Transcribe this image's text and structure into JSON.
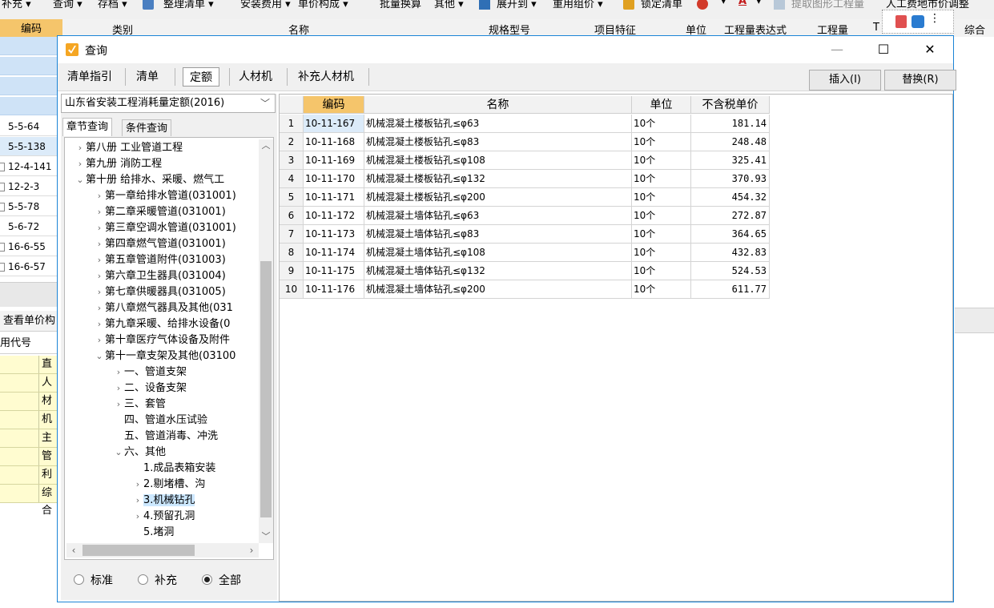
{
  "toolbar": {
    "items": [
      "补充 ▾",
      "查询 ▾",
      "存档 ▾",
      "整理清单 ▾",
      "安装费用 ▾",
      "单价构成 ▾",
      "批量换算",
      "其他 ▾",
      "展开到 ▾",
      "重用组价 ▾",
      "锁定清单",
      "▾",
      "▾",
      "提取图形工程量",
      "人工费地市价调整"
    ]
  },
  "bg_grid": {
    "headers": [
      "编码",
      "类别",
      "名称",
      "规格型号",
      "项目特征",
      "单位",
      "工程量表达式",
      "工程量",
      "T",
      "综合单"
    ],
    "rows": [
      "5-5-64",
      "5-5-138",
      "12-4-141",
      "12-2-3",
      "5-5-78",
      "5-6-72",
      "16-6-55",
      "16-6-57"
    ],
    "check_tab": "查看单价构",
    "code_header": "用代号",
    "yellow_rows": [
      "直接",
      "人工",
      "材料",
      "机械",
      "主材",
      "管理",
      "利润",
      "综合"
    ]
  },
  "dialog": {
    "title": "查询",
    "tabs": [
      "清单指引",
      "清单",
      "定额",
      "人材机",
      "补充人材机"
    ],
    "active_tab": "定额",
    "insert_button": "插入(I)",
    "replace_button": "替换(R)",
    "quota_library": "山东省安装工程消耗量定额(2016)",
    "subtabs": [
      "章节查询",
      "条件查询"
    ],
    "tree": [
      {
        "label": "第八册 工业管道工程",
        "arrow": "›"
      },
      {
        "label": "第九册 消防工程",
        "arrow": "›"
      },
      {
        "label": "第十册 给排水、采暖、燃气工",
        "arrow": "⌄"
      },
      {
        "label": "第一章给排水管道(031001)",
        "arrow": "›"
      },
      {
        "label": "第二章采暖管道(031001)",
        "arrow": "›"
      },
      {
        "label": "第三章空调水管道(031001)",
        "arrow": "›"
      },
      {
        "label": "第四章燃气管道(031001)",
        "arrow": "›"
      },
      {
        "label": "第五章管道附件(031003)",
        "arrow": "›"
      },
      {
        "label": "第六章卫生器具(031004)",
        "arrow": "›"
      },
      {
        "label": "第七章供暖器具(031005)",
        "arrow": "›"
      },
      {
        "label": "第八章燃气器具及其他(031",
        "arrow": "›"
      },
      {
        "label": "第九章采暖、给排水设备(0",
        "arrow": "›"
      },
      {
        "label": "第十章医疗气体设备及附件",
        "arrow": "›"
      },
      {
        "label": "第十一章支架及其他(03100",
        "arrow": "⌄"
      },
      {
        "label": "一、管道支架",
        "arrow": "›"
      },
      {
        "label": "二、设备支架",
        "arrow": "›"
      },
      {
        "label": "三、套管",
        "arrow": "›"
      },
      {
        "label": "四、管道水压试验",
        "arrow": ""
      },
      {
        "label": "五、管道消毒、冲洗",
        "arrow": ""
      },
      {
        "label": "六、其他",
        "arrow": "⌄"
      },
      {
        "label": "1.成品表箱安装",
        "arrow": ""
      },
      {
        "label": "2.剔堵槽、沟",
        "arrow": "›"
      },
      {
        "label": "3.机械钻孔",
        "arrow": "›"
      },
      {
        "label": "4.预留孔洞",
        "arrow": "›"
      },
      {
        "label": "5.堵洞",
        "arrow": ""
      }
    ],
    "radio_options": [
      "标准",
      "补充",
      "全部"
    ],
    "radio_selected": "全部",
    "grid": {
      "headers": [
        "编码",
        "名称",
        "单位",
        "不含税单价"
      ],
      "rows": [
        {
          "n": "1",
          "code": "10-11-167",
          "name": "机械混凝土楼板钻孔≤φ63",
          "unit": "10个",
          "price": "181.14"
        },
        {
          "n": "2",
          "code": "10-11-168",
          "name": "机械混凝土楼板钻孔≤φ83",
          "unit": "10个",
          "price": "248.48"
        },
        {
          "n": "3",
          "code": "10-11-169",
          "name": "机械混凝土楼板钻孔≤φ108",
          "unit": "10个",
          "price": "325.41"
        },
        {
          "n": "4",
          "code": "10-11-170",
          "name": "机械混凝土楼板钻孔≤φ132",
          "unit": "10个",
          "price": "370.93"
        },
        {
          "n": "5",
          "code": "10-11-171",
          "name": "机械混凝土楼板钻孔≤φ200",
          "unit": "10个",
          "price": "454.32"
        },
        {
          "n": "6",
          "code": "10-11-172",
          "name": "机械混凝土墙体钻孔≤φ63",
          "unit": "10个",
          "price": "272.87"
        },
        {
          "n": "7",
          "code": "10-11-173",
          "name": "机械混凝土墙体钻孔≤φ83",
          "unit": "10个",
          "price": "364.65"
        },
        {
          "n": "8",
          "code": "10-11-174",
          "name": "机械混凝土墙体钻孔≤φ108",
          "unit": "10个",
          "price": "432.83"
        },
        {
          "n": "9",
          "code": "10-11-175",
          "name": "机械混凝土墙体钻孔≤φ132",
          "unit": "10个",
          "price": "524.53"
        },
        {
          "n": "10",
          "code": "10-11-176",
          "name": "机械混凝土墙体钻孔≤φ200",
          "unit": "10个",
          "price": "611.77"
        }
      ]
    }
  },
  "colors": {
    "accent_border": "#1b84d6",
    "code_header": "#f5c56b",
    "selection": "#dcebf9",
    "yellow_rows": "#fffcd0"
  }
}
